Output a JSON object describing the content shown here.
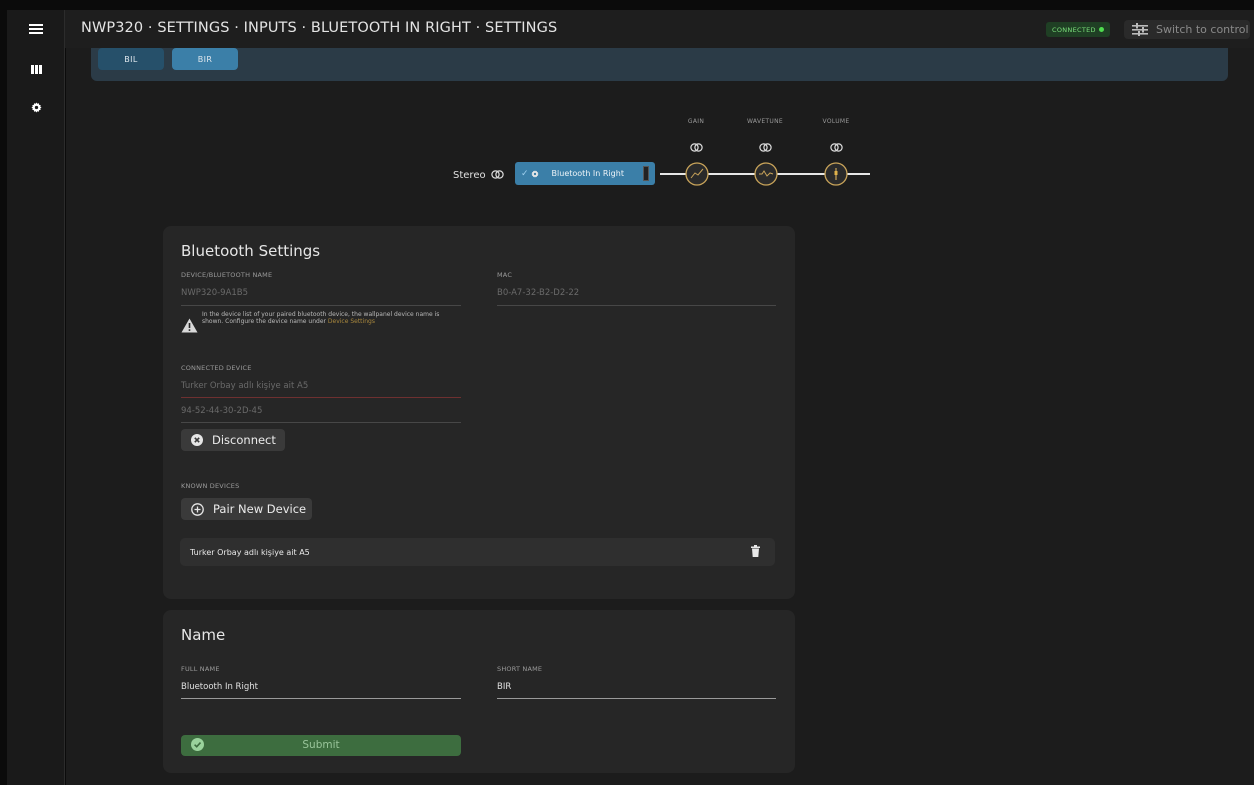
{
  "header": {
    "breadcrumb": "NWP320 · SETTINGS · INPUTS · BLUETOOTH IN RIGHT · SETTINGS",
    "status": "CONNECTED",
    "switch_label": "Switch to control"
  },
  "sidebar": {
    "icons": [
      "menu-icon",
      "channels-icon",
      "gear-icon"
    ]
  },
  "tabs": [
    {
      "label": "BIL",
      "active": false
    },
    {
      "label": "BIR",
      "active": true
    }
  ],
  "chain": {
    "stereo_label": "Stereo",
    "source_label": "Bluetooth In Right",
    "stages": [
      {
        "label": "GAIN"
      },
      {
        "label": "WAVETUNE"
      },
      {
        "label": "VOLUME"
      }
    ]
  },
  "bluetooth": {
    "title": "Bluetooth Settings",
    "device_name_label": "DEVICE/BLUETOOTH NAME",
    "device_name_value": "NWP320-9A1B5",
    "mac_label": "MAC",
    "mac_value": "B0-A7-32-B2-D2-22",
    "warning_text": "In the device list of your paired bluetooth device, the wallpanel device name is shown. Configure the device name under",
    "warning_link": "Device Settings",
    "connected_label": "CONNECTED DEVICE",
    "connected_name": "Turker Orbay adlı kişiye ait A5",
    "connected_mac": "94-52-44-30-2D-45",
    "disconnect_label": "Disconnect",
    "known_label": "KNOWN DEVICES",
    "pair_label": "Pair New Device",
    "known_devices": [
      {
        "name": "Turker Orbay adlı kişiye ait A5"
      }
    ]
  },
  "name_card": {
    "title": "Name",
    "full_name_label": "FULL NAME",
    "full_name_value": "Bluetooth In Right",
    "short_name_label": "SHORT NAME",
    "short_name_value": "BIR",
    "submit_label": "Submit"
  },
  "colors": {
    "accent_blue": "#3b7fa8",
    "status_green": "#4fdc4f",
    "submit_green": "#3d6d3f",
    "stage_ring": "#c9a45a"
  }
}
